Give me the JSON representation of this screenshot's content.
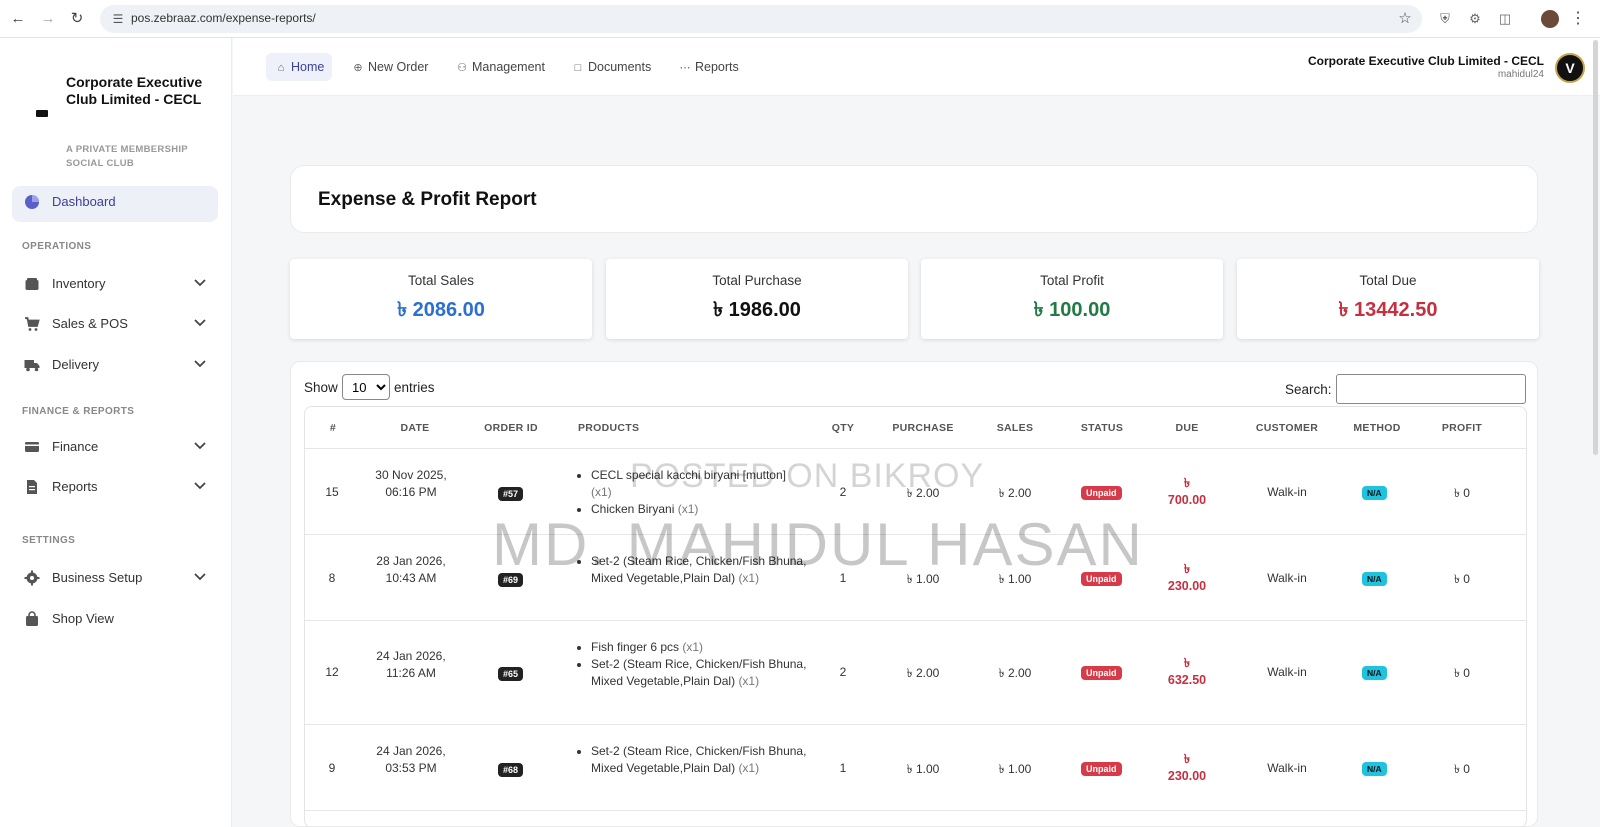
{
  "browser": {
    "url": "pos.zebraaz.com/expense-reports/"
  },
  "sidebar": {
    "brand_name": "Corporate Executive Club Limited - CECL",
    "brand_tagline": "A PRIVATE MEMBERSHIP SOCIAL CLUB",
    "dashboard_label": "Dashboard",
    "sections": {
      "operations": "OPERATIONS",
      "finance_reports": "FINANCE & REPORTS",
      "settings": "SETTINGS"
    },
    "items": {
      "inventory": "Inventory",
      "sales_pos": "Sales & POS",
      "delivery": "Delivery",
      "finance": "Finance",
      "reports": "Reports",
      "business_setup": "Business Setup",
      "shop_view": "Shop View"
    }
  },
  "topbar": {
    "nav": {
      "home": "Home",
      "new_order": "New Order",
      "management": "Management",
      "documents": "Documents",
      "reports": "Reports"
    },
    "club_name": "Corporate Executive Club Limited - CECL",
    "username": "mahidul24",
    "logo_letter": "V"
  },
  "page": {
    "title": "Expense & Profit Report"
  },
  "stats": {
    "total_sales_label": "Total Sales",
    "total_sales_value": "৳ 2086.00",
    "total_purchase_label": "Total Purchase",
    "total_purchase_value": "৳ 1986.00",
    "total_profit_label": "Total Profit",
    "total_profit_value": "৳ 100.00",
    "total_due_label": "Total Due",
    "total_due_value": "৳ 13442.50"
  },
  "colors": {
    "sales": "#2b6fd1",
    "purchase": "#111111",
    "profit": "#237a45",
    "due": "#c62f40"
  },
  "table": {
    "show_label": "Show",
    "entries_selected": "10",
    "entries_label": "entries",
    "search_label": "Search:",
    "headers": {
      "num": "#",
      "date": "DATE",
      "order_id": "ORDER ID",
      "products": "PRODUCTS",
      "qty": "QTY",
      "purchase": "PURCHASE",
      "sales": "SALES",
      "status": "STATUS",
      "due": "DUE",
      "customer": "CUSTOMER",
      "method": "METHOD",
      "profit": "PROFIT"
    },
    "rows": [
      {
        "num": "15",
        "date": "30 Nov 2025, 06:16 PM",
        "order_id": "#57",
        "products": [
          {
            "name": "CECL special kacchi biryani [mutton]",
            "qty": "(x1)"
          },
          {
            "name": "Chicken Biryani",
            "qty": "(x1)"
          }
        ],
        "qty": "2",
        "purchase": "৳ 2.00",
        "sales": "৳ 2.00",
        "status": "Unpaid",
        "due_symbol": "৳",
        "due_amount": "700.00",
        "customer": "Walk-in",
        "method": "N/A",
        "profit": "৳ 0"
      },
      {
        "num": "8",
        "date": "28 Jan 2026, 10:43 AM",
        "order_id": "#69",
        "products": [
          {
            "name": "Set-2 (Steam Rice, Chicken/Fish Bhuna, Mixed Vegetable,Plain Dal)",
            "qty": "(x1)"
          }
        ],
        "qty": "1",
        "purchase": "৳ 1.00",
        "sales": "৳ 1.00",
        "status": "Unpaid",
        "due_symbol": "৳",
        "due_amount": "230.00",
        "customer": "Walk-in",
        "method": "N/A",
        "profit": "৳ 0"
      },
      {
        "num": "12",
        "date": "24 Jan 2026, 11:26 AM",
        "order_id": "#65",
        "products": [
          {
            "name": "Fish finger 6 pcs",
            "qty": "(x1)"
          },
          {
            "name": "Set-2 (Steam Rice, Chicken/Fish Bhuna, Mixed Vegetable,Plain Dal)",
            "qty": "(x1)"
          }
        ],
        "qty": "2",
        "purchase": "৳ 2.00",
        "sales": "৳ 2.00",
        "status": "Unpaid",
        "due_symbol": "৳",
        "due_amount": "632.50",
        "customer": "Walk-in",
        "method": "N/A",
        "profit": "৳ 0"
      },
      {
        "num": "9",
        "date": "24 Jan 2026, 03:53 PM",
        "order_id": "#68",
        "products": [
          {
            "name": "Set-2 (Steam Rice, Chicken/Fish Bhuna, Mixed Vegetable,Plain Dal)",
            "qty": "(x1)"
          }
        ],
        "qty": "1",
        "purchase": "৳ 1.00",
        "sales": "৳ 1.00",
        "status": "Unpaid",
        "due_symbol": "৳",
        "due_amount": "230.00",
        "customer": "Walk-in",
        "method": "N/A",
        "profit": "৳ 0"
      }
    ]
  },
  "watermark": {
    "line1": "POSTED ON BIKROY",
    "line2": "MD. MAHIDUL HASAN"
  }
}
